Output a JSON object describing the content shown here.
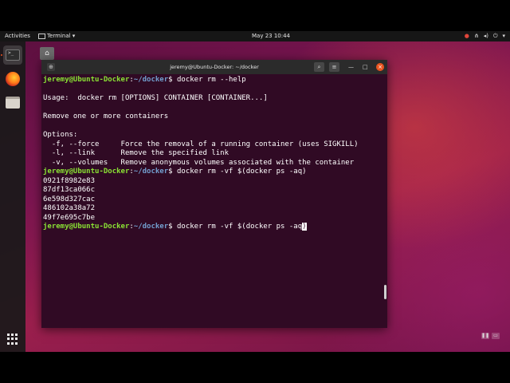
{
  "topbar": {
    "activities": "Activities",
    "app_menu": "Terminal ▾",
    "clock": "May 23  10:44"
  },
  "terminal_window": {
    "title": "jeremy@Ubuntu-Docker: ~/docker",
    "prompt_user": "jeremy@Ubuntu-Docker",
    "prompt_path": "~/docker",
    "lines": [
      {
        "kind": "prompt",
        "cmd": " docker rm --help"
      },
      {
        "kind": "text",
        "text": ""
      },
      {
        "kind": "text",
        "text": "Usage:  docker rm [OPTIONS] CONTAINER [CONTAINER...]"
      },
      {
        "kind": "text",
        "text": ""
      },
      {
        "kind": "text",
        "text": "Remove one or more containers"
      },
      {
        "kind": "text",
        "text": ""
      },
      {
        "kind": "text",
        "text": "Options:"
      },
      {
        "kind": "text",
        "text": "  -f, --force     Force the removal of a running container (uses SIGKILL)"
      },
      {
        "kind": "text",
        "text": "  -l, --link      Remove the specified link"
      },
      {
        "kind": "text",
        "text": "  -v, --volumes   Remove anonymous volumes associated with the container"
      },
      {
        "kind": "prompt",
        "cmd": " docker rm -vf $(docker ps -aq)"
      },
      {
        "kind": "text",
        "text": "0921f8982e83"
      },
      {
        "kind": "text",
        "text": "87df13ca066c"
      },
      {
        "kind": "text",
        "text": "6e598d327cac"
      },
      {
        "kind": "text",
        "text": "486102a38a72"
      },
      {
        "kind": "text",
        "text": "49f7e695c7be"
      },
      {
        "kind": "prompt_active",
        "cmd": " docker rm -vf $(docker ps -aq",
        "cursor": ")"
      }
    ]
  },
  "icons": {
    "dock": [
      "terminal-icon",
      "firefox-icon",
      "files-icon",
      "show-apps-icon"
    ],
    "tray": [
      "alert-icon",
      "network-icon",
      "volume-icon",
      "power-icon"
    ]
  },
  "colors": {
    "terminal_bg": "#300a24",
    "prompt_user": "#8ae234",
    "prompt_path": "#729fcf",
    "accent": "#e95420"
  }
}
